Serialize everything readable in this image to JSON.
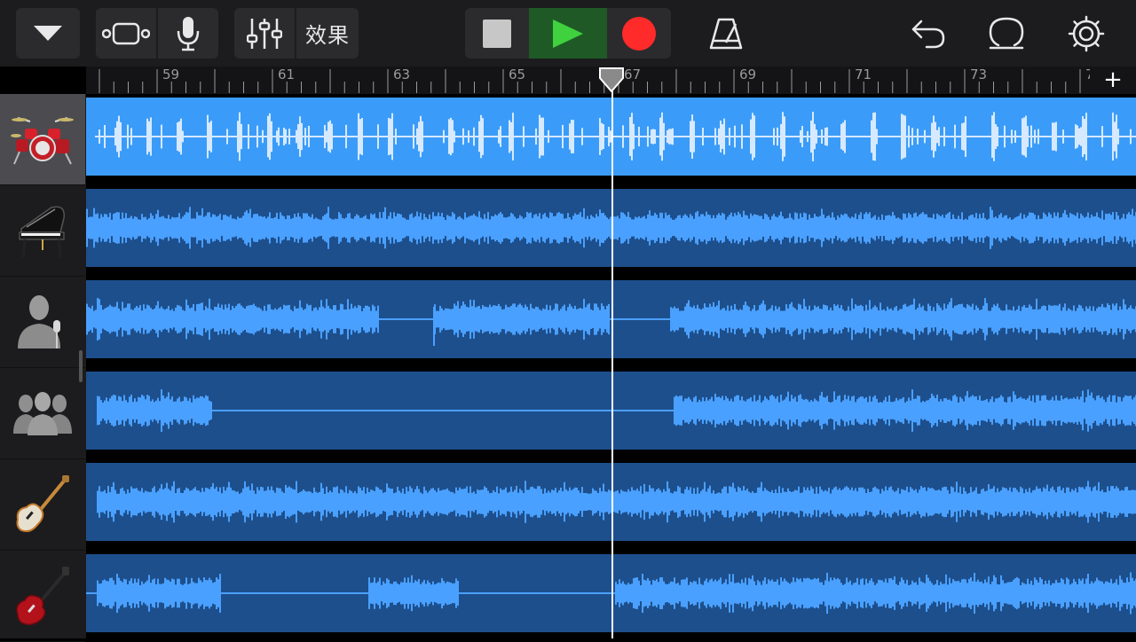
{
  "toolbar": {
    "effects_label": "效果",
    "colors": {
      "play_bg": "#1f5a26",
      "play": "#3fd13e",
      "record": "#ff2a2a",
      "stop": "#c7c7c7"
    }
  },
  "ruler": {
    "bar_labels": [
      "59",
      "61",
      "63",
      "65",
      "67",
      "69",
      "71",
      "73",
      "7"
    ],
    "add_label": "+"
  },
  "tracks": [
    {
      "instrument": "drum-kit",
      "selected": true
    },
    {
      "instrument": "grand-piano",
      "selected": false
    },
    {
      "instrument": "vocalist",
      "selected": false
    },
    {
      "instrument": "choir",
      "selected": false
    },
    {
      "instrument": "bass-guitar",
      "selected": false
    },
    {
      "instrument": "electric-guitar",
      "selected": false
    }
  ],
  "colors": {
    "region_selected": "#3a9cf8",
    "waveform_selected": "#d6e9ff",
    "region": "#1d4f8c",
    "waveform": "#4aa0ff"
  }
}
